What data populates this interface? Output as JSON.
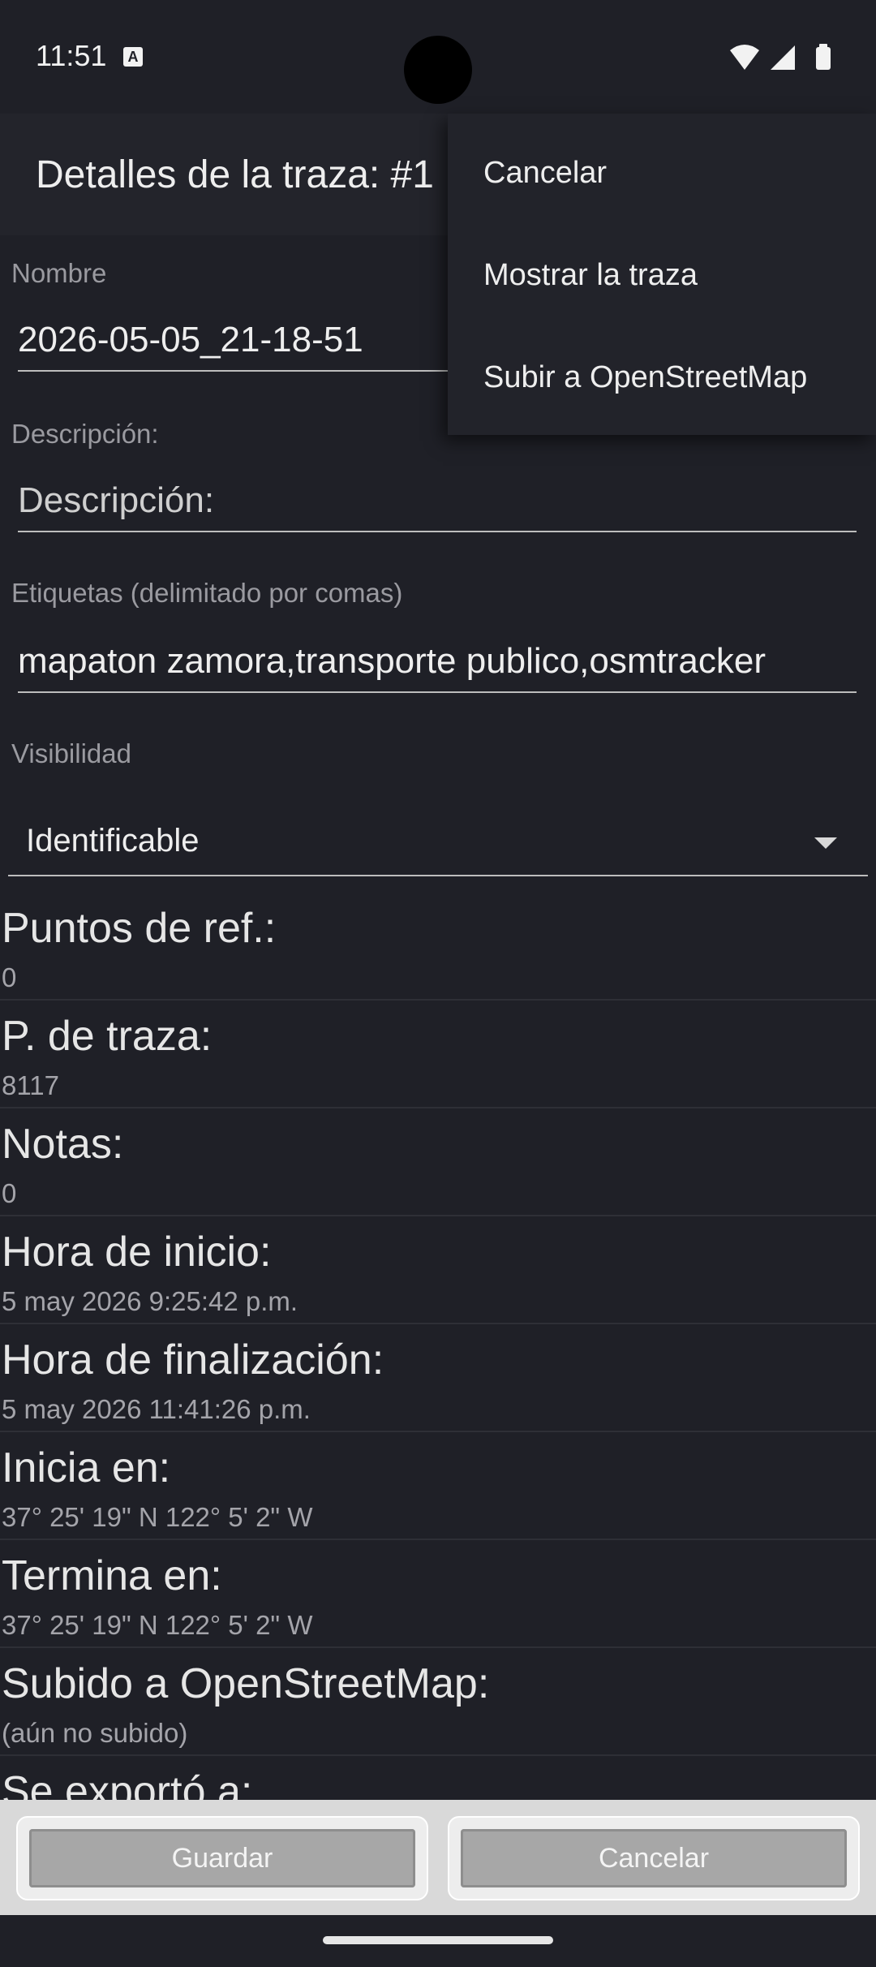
{
  "status_bar": {
    "time": "11:51",
    "a_icon": "A"
  },
  "app_bar": {
    "title": "Detalles de la traza: #1"
  },
  "form": {
    "name_label": "Nombre",
    "name_value": "2026-05-05_21-18-51",
    "description_label": "Descripción:",
    "description_placeholder": "Descripción:",
    "tags_label": "Etiquetas (delimitado por comas)",
    "tags_value": "mapaton zamora,transporte publico,osmtracker",
    "visibility_label": "Visibilidad",
    "visibility_value": "Identificable"
  },
  "info": [
    {
      "title": "Puntos de ref.:",
      "value": "0"
    },
    {
      "title": "P. de traza:",
      "value": "8117"
    },
    {
      "title": "Notas:",
      "value": "0"
    },
    {
      "title": "Hora de inicio:",
      "value": "5 may 2026 9:25:42 p.m."
    },
    {
      "title": "Hora de finalización:",
      "value": "5 may 2026 11:41:26 p.m."
    },
    {
      "title": "Inicia en:",
      "value": "37° 25' 19\" N  122° 5' 2\" W"
    },
    {
      "title": "Termina en:",
      "value": "37° 25' 19\" N  122° 5' 2\" W"
    },
    {
      "title": "Subido a OpenStreetMap:",
      "value": "(aún no subido)"
    },
    {
      "title": "Se exportó a:",
      "value": ""
    }
  ],
  "buttons": {
    "save": "Guardar",
    "cancel": "Cancelar"
  },
  "menu": {
    "items": [
      "Cancelar",
      "Mostrar la traza",
      "Subir a OpenStreetMap"
    ]
  },
  "icons": {
    "wifi": "wifi-icon",
    "signal": "cell-signal-icon",
    "battery": "battery-icon",
    "dropdown": "dropdown-arrow-icon"
  }
}
